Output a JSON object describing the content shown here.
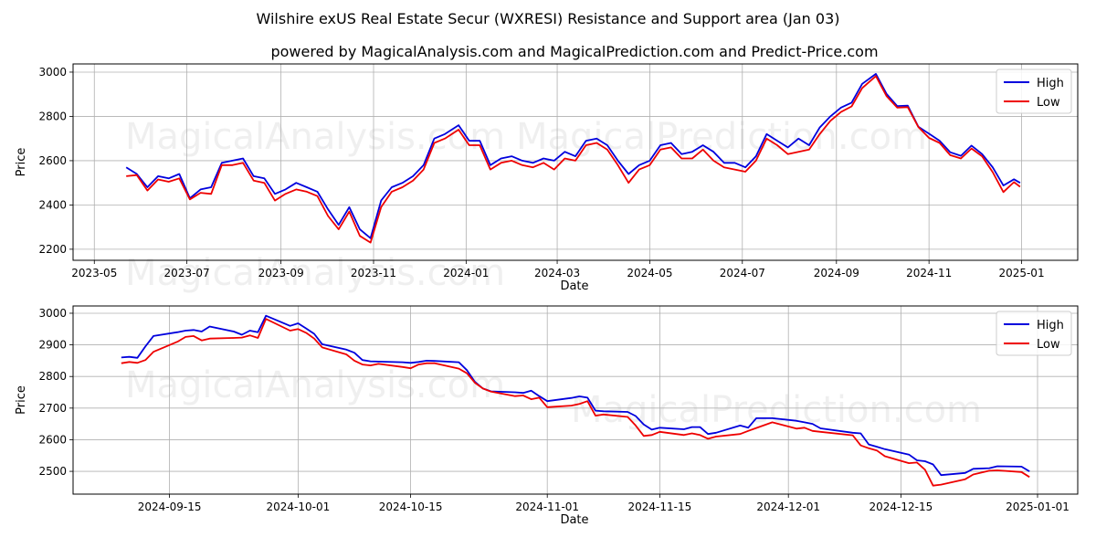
{
  "title": "Wilshire exUS Real Estate Secur (WXRESI) Resistance and Support area (Jan 03)",
  "subtitle": "powered by MagicalAnalysis.com and MagicalPrediction.com and Predict-Price.com",
  "watermarks": [
    "MagicalAnalysis.com",
    "MagicalPrediction.com"
  ],
  "colors": {
    "high": "#0000dd",
    "low": "#ee0000",
    "grid": "#b0b0b0"
  },
  "chart_data": [
    {
      "type": "line",
      "xlabel": "Date",
      "ylabel": "Price",
      "xlim": [
        "2023-04-17",
        "2025-02-07"
      ],
      "ylim": [
        2150,
        3037
      ],
      "grid": true,
      "legend": "top-right",
      "xticks": [
        "2023-05-01",
        "2023-07-01",
        "2023-09-01",
        "2023-11-01",
        "2024-01-01",
        "2024-03-01",
        "2024-05-01",
        "2024-07-01",
        "2024-09-01",
        "2024-11-01",
        "2025-01-01"
      ],
      "xtick_labels": [
        "2023-05",
        "2023-07",
        "2023-09",
        "2023-11",
        "2024-01",
        "2024-03",
        "2024-05",
        "2024-07",
        "2024-09",
        "2024-11",
        "2025-01"
      ],
      "yticks": [
        2200,
        2400,
        2600,
        2800,
        3000
      ],
      "ytick_labels": [
        "2200",
        "2400",
        "2600",
        "2800",
        "3000"
      ],
      "x": [
        "2023-05-22",
        "2023-05-29",
        "2023-06-05",
        "2023-06-12",
        "2023-06-19",
        "2023-06-26",
        "2023-07-03",
        "2023-07-10",
        "2023-07-17",
        "2023-07-24",
        "2023-07-31",
        "2023-08-07",
        "2023-08-14",
        "2023-08-21",
        "2023-08-28",
        "2023-09-04",
        "2023-09-11",
        "2023-09-18",
        "2023-09-25",
        "2023-10-02",
        "2023-10-09",
        "2023-10-16",
        "2023-10-23",
        "2023-10-30",
        "2023-11-06",
        "2023-11-13",
        "2023-11-20",
        "2023-11-27",
        "2023-12-04",
        "2023-12-11",
        "2023-12-18",
        "2023-12-27",
        "2024-01-03",
        "2024-01-10",
        "2024-01-17",
        "2024-01-24",
        "2024-01-31",
        "2024-02-07",
        "2024-02-14",
        "2024-02-21",
        "2024-02-28",
        "2024-03-06",
        "2024-03-13",
        "2024-03-20",
        "2024-03-27",
        "2024-04-03",
        "2024-04-10",
        "2024-04-17",
        "2024-04-24",
        "2024-05-01",
        "2024-05-08",
        "2024-05-15",
        "2024-05-22",
        "2024-05-29",
        "2024-06-05",
        "2024-06-12",
        "2024-06-19",
        "2024-06-26",
        "2024-07-03",
        "2024-07-10",
        "2024-07-17",
        "2024-07-24",
        "2024-07-31",
        "2024-08-07",
        "2024-08-14",
        "2024-08-21",
        "2024-08-28",
        "2024-09-04",
        "2024-09-11",
        "2024-09-18",
        "2024-09-27",
        "2024-10-04",
        "2024-10-11",
        "2024-10-18",
        "2024-10-25",
        "2024-11-01",
        "2024-11-08",
        "2024-11-15",
        "2024-11-22",
        "2024-11-29",
        "2024-12-06",
        "2024-12-13",
        "2024-12-20",
        "2024-12-27",
        "2024-12-31"
      ],
      "series": [
        {
          "name": "High",
          "values": [
            2570,
            2540,
            2480,
            2530,
            2520,
            2540,
            2430,
            2470,
            2480,
            2590,
            2600,
            2610,
            2530,
            2520,
            2450,
            2470,
            2500,
            2480,
            2460,
            2380,
            2310,
            2390,
            2290,
            2250,
            2420,
            2480,
            2500,
            2530,
            2580,
            2700,
            2720,
            2760,
            2690,
            2690,
            2580,
            2610,
            2620,
            2600,
            2590,
            2610,
            2600,
            2640,
            2620,
            2690,
            2700,
            2670,
            2600,
            2540,
            2580,
            2600,
            2670,
            2680,
            2630,
            2640,
            2670,
            2640,
            2590,
            2590,
            2570,
            2620,
            2720,
            2690,
            2660,
            2700,
            2670,
            2750,
            2800,
            2840,
            2862,
            2947,
            2992,
            2902,
            2847,
            2849,
            2753,
            2722,
            2690,
            2638,
            2622,
            2668,
            2630,
            2570,
            2488,
            2516,
            2500
          ]
        },
        {
          "name": "Low",
          "values": [
            2530,
            2535,
            2465,
            2515,
            2505,
            2520,
            2425,
            2455,
            2450,
            2580,
            2580,
            2590,
            2510,
            2500,
            2420,
            2450,
            2470,
            2460,
            2440,
            2350,
            2290,
            2370,
            2260,
            2230,
            2390,
            2460,
            2480,
            2510,
            2560,
            2680,
            2700,
            2740,
            2670,
            2670,
            2560,
            2590,
            2600,
            2580,
            2570,
            2590,
            2560,
            2610,
            2600,
            2670,
            2680,
            2650,
            2580,
            2500,
            2560,
            2580,
            2650,
            2660,
            2610,
            2610,
            2650,
            2600,
            2570,
            2560,
            2550,
            2600,
            2700,
            2670,
            2630,
            2640,
            2650,
            2720,
            2780,
            2820,
            2845,
            2928,
            2982,
            2892,
            2840,
            2842,
            2752,
            2703,
            2680,
            2625,
            2610,
            2655,
            2620,
            2548,
            2458,
            2503,
            2482
          ]
        }
      ]
    },
    {
      "type": "line",
      "xlabel": "Date",
      "ylabel": "Price",
      "xlim": [
        "2024-09-03",
        "2025-01-06"
      ],
      "ylim": [
        2428,
        3023
      ],
      "grid": true,
      "legend": "top-right",
      "xticks": [
        "2024-09-15",
        "2024-10-01",
        "2024-10-15",
        "2024-11-01",
        "2024-11-15",
        "2024-12-01",
        "2024-12-15",
        "2025-01-01"
      ],
      "xtick_labels": [
        "2024-09-15",
        "2024-10-01",
        "2024-10-15",
        "2024-11-01",
        "2024-11-15",
        "2024-12-01",
        "2024-12-15",
        "2025-01-01"
      ],
      "yticks": [
        2500,
        2600,
        2700,
        2800,
        2900,
        3000
      ],
      "ytick_labels": [
        "2500",
        "2600",
        "2700",
        "2800",
        "2900",
        "3000"
      ],
      "x": [
        "2024-09-09",
        "2024-09-10",
        "2024-09-11",
        "2024-09-12",
        "2024-09-13",
        "2024-09-16",
        "2024-09-17",
        "2024-09-18",
        "2024-09-19",
        "2024-09-20",
        "2024-09-23",
        "2024-09-24",
        "2024-09-25",
        "2024-09-26",
        "2024-09-27",
        "2024-09-30",
        "2024-10-01",
        "2024-10-02",
        "2024-10-03",
        "2024-10-04",
        "2024-10-07",
        "2024-10-08",
        "2024-10-09",
        "2024-10-10",
        "2024-10-11",
        "2024-10-14",
        "2024-10-15",
        "2024-10-16",
        "2024-10-17",
        "2024-10-18",
        "2024-10-21",
        "2024-10-22",
        "2024-10-23",
        "2024-10-24",
        "2024-10-25",
        "2024-10-28",
        "2024-10-29",
        "2024-10-30",
        "2024-10-31",
        "2024-11-01",
        "2024-11-04",
        "2024-11-05",
        "2024-11-06",
        "2024-11-07",
        "2024-11-08",
        "2024-11-11",
        "2024-11-12",
        "2024-11-13",
        "2024-11-14",
        "2024-11-15",
        "2024-11-18",
        "2024-11-19",
        "2024-11-20",
        "2024-11-21",
        "2024-11-22",
        "2024-11-25",
        "2024-11-26",
        "2024-11-27",
        "2024-11-29",
        "2024-12-02",
        "2024-12-03",
        "2024-12-04",
        "2024-12-05",
        "2024-12-09",
        "2024-12-10",
        "2024-12-11",
        "2024-12-12",
        "2024-12-13",
        "2024-12-16",
        "2024-12-17",
        "2024-12-18",
        "2024-12-19",
        "2024-12-20",
        "2024-12-23",
        "2024-12-24",
        "2024-12-26",
        "2024-12-27",
        "2024-12-30",
        "2024-12-31"
      ],
      "series": [
        {
          "name": "High",
          "values": [
            2860,
            2862,
            2859,
            2895,
            2928,
            2940,
            2945,
            2947,
            2942,
            2958,
            2942,
            2932,
            2945,
            2940,
            2992,
            2960,
            2968,
            2952,
            2935,
            2902,
            2885,
            2875,
            2852,
            2848,
            2847,
            2845,
            2843,
            2846,
            2850,
            2849,
            2845,
            2820,
            2783,
            2762,
            2753,
            2750,
            2748,
            2755,
            2738,
            2722,
            2732,
            2737,
            2733,
            2692,
            2690,
            2688,
            2675,
            2648,
            2632,
            2638,
            2633,
            2640,
            2640,
            2618,
            2622,
            2645,
            2638,
            2668,
            2668,
            2660,
            2655,
            2650,
            2636,
            2622,
            2620,
            2585,
            2578,
            2570,
            2553,
            2535,
            2532,
            2522,
            2488,
            2495,
            2508,
            2510,
            2516,
            2515,
            2500
          ]
        },
        {
          "name": "Low",
          "values": [
            2842,
            2846,
            2843,
            2852,
            2878,
            2910,
            2925,
            2928,
            2914,
            2920,
            2922,
            2923,
            2930,
            2922,
            2982,
            2945,
            2950,
            2938,
            2920,
            2892,
            2870,
            2850,
            2838,
            2835,
            2840,
            2830,
            2826,
            2838,
            2842,
            2842,
            2825,
            2810,
            2780,
            2762,
            2752,
            2738,
            2740,
            2728,
            2733,
            2703,
            2708,
            2713,
            2722,
            2676,
            2680,
            2672,
            2645,
            2612,
            2615,
            2625,
            2615,
            2620,
            2615,
            2603,
            2610,
            2618,
            2628,
            2637,
            2655,
            2635,
            2638,
            2628,
            2625,
            2614,
            2582,
            2573,
            2566,
            2548,
            2526,
            2528,
            2505,
            2455,
            2458,
            2475,
            2490,
            2502,
            2503,
            2498,
            2482
          ]
        }
      ]
    }
  ]
}
